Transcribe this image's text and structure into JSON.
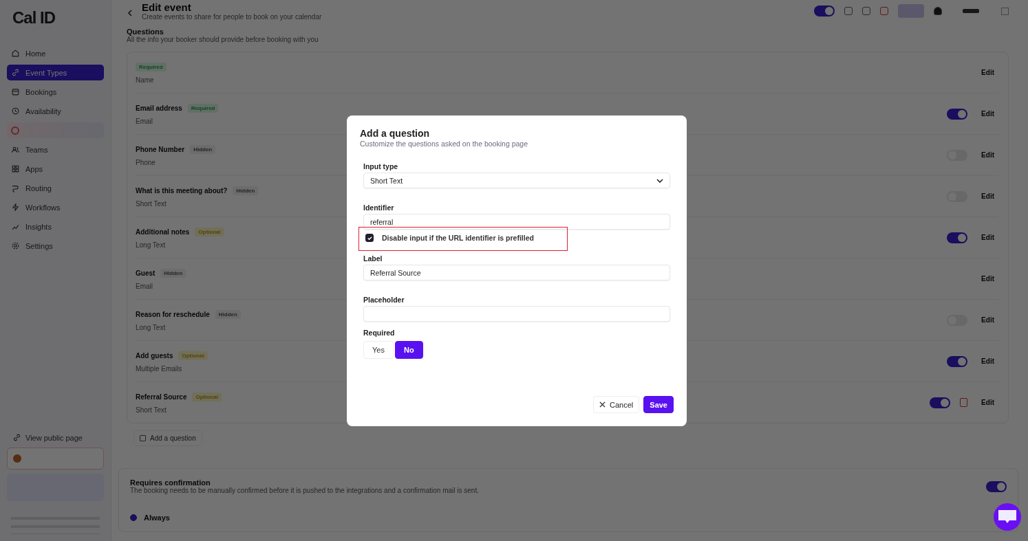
{
  "sidebar": {
    "logo": "Cal ID",
    "items": [
      {
        "label": "Home",
        "selected": false
      },
      {
        "label": "Event Types",
        "selected": true
      },
      {
        "label": "Bookings",
        "selected": false
      },
      {
        "label": "Availability",
        "selected": false
      },
      {
        "label": "Teams",
        "selected": false
      },
      {
        "label": "Apps",
        "selected": false
      },
      {
        "label": "Routing",
        "selected": false
      },
      {
        "label": "Workflows",
        "selected": false
      },
      {
        "label": "Insights",
        "selected": false
      },
      {
        "label": "Settings",
        "selected": false
      }
    ],
    "footer_link": "View public page"
  },
  "header": {
    "title": "Edit event",
    "subtitle": "Create events to share for people to book on your calendar",
    "hidden_toggle": {
      "on": true
    }
  },
  "questions": {
    "title": "Questions",
    "description": "All the info your booker should provide before booking with you",
    "items": [
      {
        "badge": {
          "text": "Required",
          "kind": "required"
        },
        "type": "Name",
        "deletable": false,
        "edit": "Edit"
      },
      {
        "label": "Email address",
        "badge": {
          "text": "Required",
          "kind": "required"
        },
        "type": "Email",
        "switch_on": true,
        "deletable": false,
        "edit": "Edit"
      },
      {
        "label": "Phone Number",
        "badge": {
          "text": "Hidden",
          "kind": "hidden"
        },
        "type": "Phone",
        "switch_on": false,
        "deletable": false,
        "edit": "Edit"
      },
      {
        "label": "What is this meeting about?",
        "badge": {
          "text": "Hidden",
          "kind": "hidden"
        },
        "type": "Short Text",
        "switch_on": false,
        "deletable": false,
        "edit": "Edit"
      },
      {
        "label": "Additional notes",
        "badge": {
          "text": "Optional",
          "kind": "optional"
        },
        "type": "Long Text",
        "switch_on": true,
        "deletable": false,
        "edit": "Edit"
      },
      {
        "label": "Guest",
        "badge": {
          "text": "Hidden",
          "kind": "hidden"
        },
        "type": "Email",
        "deletable": false,
        "edit": "Edit"
      },
      {
        "label": "Reason for reschedule",
        "badge": {
          "text": "Hidden",
          "kind": "hidden"
        },
        "type": "Long Text",
        "switch_on": false,
        "deletable": false,
        "edit": "Edit"
      },
      {
        "label": "Add guests",
        "badge": {
          "text": "Optional",
          "kind": "optional"
        },
        "type": "Multiple Emails",
        "switch_on": true,
        "deletable": false,
        "edit": "Edit"
      },
      {
        "label": "Referral Source",
        "badge": {
          "text": "Optional",
          "kind": "optional"
        },
        "type": "Short Text",
        "switch_on": true,
        "deletable": true,
        "edit": "Edit"
      }
    ],
    "add_button": "Add a question"
  },
  "confirmation": {
    "title": "Requires confirmation",
    "description": "The booking needs to be manually confirmed before it is pushed to the integrations and a confirmation mail is sent.",
    "on": true,
    "option": {
      "label": "Always",
      "selected": true
    }
  },
  "dialog": {
    "title": "Add a question",
    "subtitle": "Customize the questions asked on the booking page",
    "input_type": {
      "label": "Input type",
      "value": "Short Text"
    },
    "identifier": {
      "label": "Identifier",
      "value": "referral"
    },
    "disable_prefilled": {
      "label": "Disable input if the URL identifier is prefilled",
      "checked": true,
      "highlighted": true
    },
    "label_field": {
      "label": "Label",
      "value": "Referral Source"
    },
    "placeholder_field": {
      "label": "Placeholder"
    },
    "required": {
      "label": "Required",
      "options": [
        {
          "label": "Yes",
          "selected": false
        },
        {
          "label": "No",
          "selected": true
        }
      ]
    },
    "buttons": [
      {
        "label": "Cancel",
        "kind": "secondary"
      },
      {
        "label": "Save",
        "kind": "primary"
      }
    ]
  }
}
